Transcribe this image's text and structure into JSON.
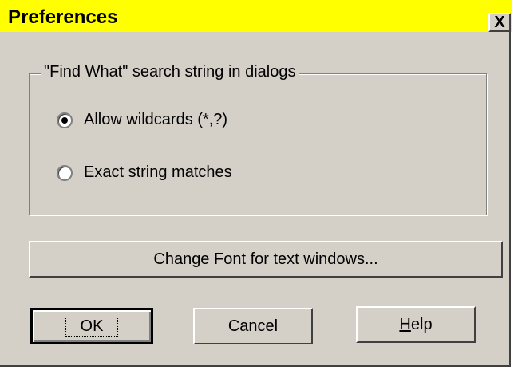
{
  "dialog": {
    "title": "Preferences",
    "close_glyph": "X"
  },
  "search_group": {
    "legend": "\"Find What\" search string in dialogs",
    "options": [
      {
        "label": "Allow wildcards (*,?)",
        "checked": true
      },
      {
        "label": "Exact string matches",
        "checked": false
      }
    ]
  },
  "buttons": {
    "change_font": "Change Font for text windows...",
    "ok": "OK",
    "cancel": "Cancel",
    "help_mnemonic": "H",
    "help_rest": "elp"
  },
  "colors": {
    "title_bar": "#ffff00",
    "face": "#d4d0c8"
  },
  "icons": {
    "close": "close-icon",
    "radio": "radio-button"
  }
}
